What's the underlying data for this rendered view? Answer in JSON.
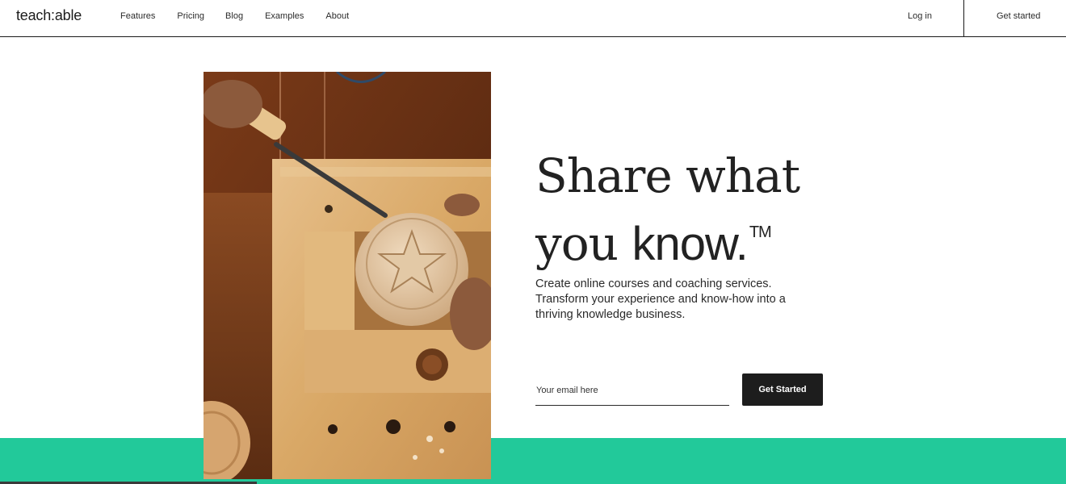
{
  "header": {
    "logo": "teach:able",
    "nav": [
      "Features",
      "Pricing",
      "Blog",
      "Examples",
      "About"
    ],
    "login": "Log in",
    "get_started": "Get started"
  },
  "hero": {
    "headline_line1": "Share what",
    "headline_line2_prefix": "you",
    "headline_line2_bold": "know.",
    "trademark": "TM",
    "subtext": "Create online courses and coaching services. Transform your experience and know-how into a thriving knowledge business.",
    "email_placeholder": "Your email here",
    "cta_label": "Get Started"
  },
  "colors": {
    "accent_green": "#22c99a",
    "button_dark": "#1d1d1d"
  },
  "icons": {
    "hero_image": "woodcarving-photo"
  }
}
